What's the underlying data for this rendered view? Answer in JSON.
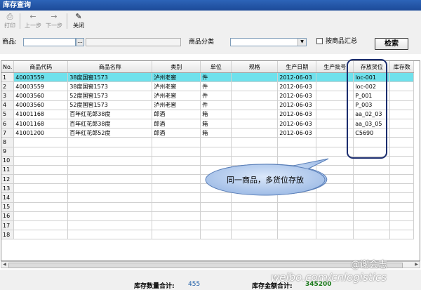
{
  "window": {
    "title": "库存查询"
  },
  "toolbar": {
    "print": "打印",
    "prev": "上一步",
    "next": "下一步",
    "close": "关闭"
  },
  "search": {
    "product_label": "商品:",
    "ellipsis": "…",
    "category_label": "商品分类",
    "summary_label": "按商品汇总",
    "search_button": "检索"
  },
  "table": {
    "columns": [
      "No.",
      "商品代码",
      "商品名称",
      "类别",
      "单位",
      "规格",
      "生产日期",
      "生产批号",
      "存放货位",
      "库存数"
    ],
    "rows": [
      {
        "no": "1",
        "code": "40003559",
        "name": "38度国窖1573",
        "cat": "泸州老窖",
        "unit": "件",
        "spec": "",
        "date": "2012-06-03",
        "batch": "",
        "loc": "loc-001"
      },
      {
        "no": "2",
        "code": "40003559",
        "name": "38度国窖1573",
        "cat": "泸州老窖",
        "unit": "件",
        "spec": "",
        "date": "2012-06-03",
        "batch": "",
        "loc": "loc-002"
      },
      {
        "no": "3",
        "code": "40003560",
        "name": "52度国窖1573",
        "cat": "泸州老窖",
        "unit": "件",
        "spec": "",
        "date": "2012-06-03",
        "batch": "",
        "loc": "P_001"
      },
      {
        "no": "4",
        "code": "40003560",
        "name": "52度国窖1573",
        "cat": "泸州老窖",
        "unit": "件",
        "spec": "",
        "date": "2012-06-03",
        "batch": "",
        "loc": "P_003"
      },
      {
        "no": "5",
        "code": "41001168",
        "name": "百年红花郎38度",
        "cat": "郎酒",
        "unit": "箱",
        "spec": "",
        "date": "2012-06-03",
        "batch": "",
        "loc": "aa_02_03"
      },
      {
        "no": "6",
        "code": "41001168",
        "name": "百年红花郎38度",
        "cat": "郎酒",
        "unit": "箱",
        "spec": "",
        "date": "2012-06-03",
        "batch": "",
        "loc": "aa_03_05"
      },
      {
        "no": "7",
        "code": "41001200",
        "name": "百年红花郎52度",
        "cat": "郎酒",
        "unit": "箱",
        "spec": "",
        "date": "2012-06-03",
        "batch": "",
        "loc": "C5690"
      },
      {
        "no": "8"
      },
      {
        "no": "9"
      },
      {
        "no": "10"
      },
      {
        "no": "11"
      },
      {
        "no": "12"
      },
      {
        "no": "13"
      },
      {
        "no": "14"
      },
      {
        "no": "15"
      },
      {
        "no": "16"
      },
      {
        "no": "17"
      },
      {
        "no": "18"
      }
    ]
  },
  "callout": {
    "text": "同一商品，多货位存放"
  },
  "footer": {
    "qty_label": "库存数量合计:",
    "qty_value": "455",
    "amount_label": "库存金额合计:",
    "amount_value": "345200"
  },
  "watermark": {
    "url": "weibo.com/cnlogistics",
    "handle": "@谢会志"
  },
  "colors": {
    "title_bar": "#1c4a98",
    "selected_row": "#6fe1ec",
    "highlight": "#1b2d6e",
    "callout_fill": "#b8d0f0"
  }
}
